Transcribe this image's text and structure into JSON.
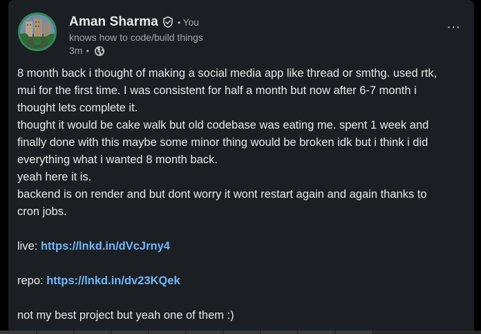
{
  "post": {
    "author": {
      "name": "Aman Sharma",
      "relation": "You",
      "headline": "knows how to code/build things",
      "time": "3m",
      "visibility_icon": "globe-icon",
      "verified_icon": "verified-badge-icon"
    },
    "menu_label": "···",
    "lines": [
      "8 month back i thought of making a social media app like thread or smthg. used rtk,",
      "mui for the first time. I was consistent for half a month but now after 6-7 month i",
      "thought lets complete it.",
      "thought it would be cake walk but old codebase was eating me. spent 1 week and",
      "finally done with this maybe some minor thing would be broken idk but i think i did",
      "everything what i wanted 8 month back.",
      "yeah here it is.",
      "backend is on render and but dont worry it wont restart again and again thanks to",
      "cron jobs."
    ],
    "live": {
      "label": "live:",
      "url": "https://lnkd.in/dVcJrny4"
    },
    "repo": {
      "label": "repo:",
      "url": "https://lnkd.in/dv23KQek"
    },
    "closing": "not my best project but yeah one of them :)"
  },
  "colors": {
    "card_bg": "#1b1f23",
    "text": "#e6e6e6",
    "muted": "#a3a3a3",
    "link": "#71b7fb",
    "avatar_ring": "#2e8b57"
  }
}
